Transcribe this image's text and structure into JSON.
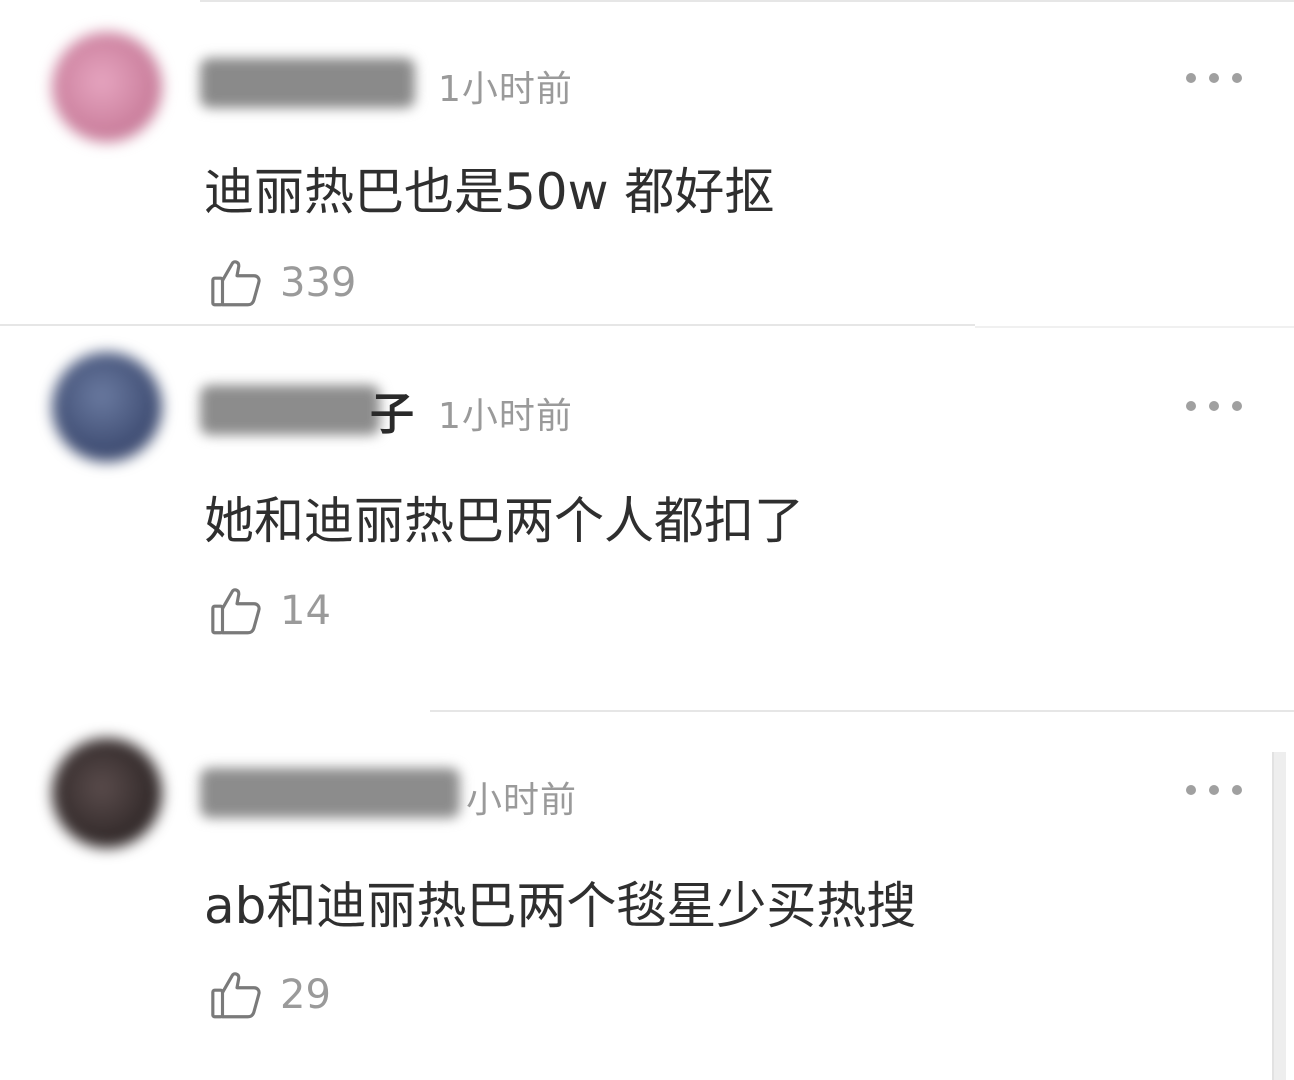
{
  "comments": [
    {
      "time": "1小时前",
      "text": "迪丽热巴也是50w 都好抠",
      "likes": "339",
      "avatar_color": "#d48aa8",
      "username_blur_color": "#8c8c8c"
    },
    {
      "time": "1小时前",
      "text": "她和迪丽热巴两个人都扣了",
      "likes": "14",
      "avatar_color": "#4a5a80",
      "username_blur_color": "#8c8c8c",
      "username_visible_fragment": "子"
    },
    {
      "time": "小时前",
      "text": "ab和迪丽热巴两个毯星少买热搜",
      "likes": "29",
      "avatar_color": "#3d3535",
      "username_blur_color": "#8c8c8c"
    }
  ],
  "icons": {
    "like": "thumbs-up-icon",
    "more": "more-dots-icon"
  }
}
